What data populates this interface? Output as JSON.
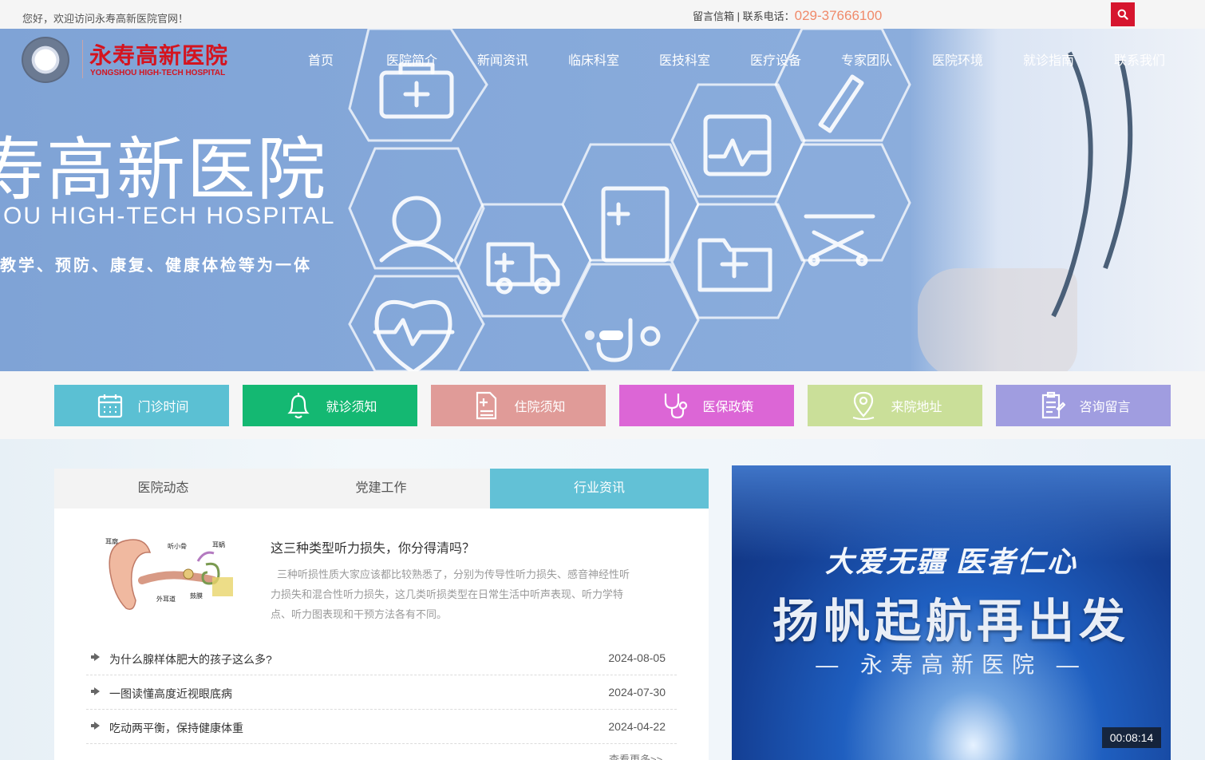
{
  "topbar": {
    "welcome": "您好，欢迎访问永寿高新医院官网！",
    "contact_label": "留言信箱 | 联系电话：",
    "phone": "029-37666100"
  },
  "logo": {
    "name_cn": "永寿高新医院",
    "name_en": "YONGSHOU HIGH-TECH HOSPITAL"
  },
  "nav": [
    "首页",
    "医院简介",
    "新闻资讯",
    "临床科室",
    "医技科室",
    "医疗设备",
    "专家团队",
    "医院环境",
    "就诊指南",
    "联系我们"
  ],
  "hero": {
    "title": "寿高新医院",
    "subtitle_en": "OU HIGH-TECH HOSPITAL",
    "slogan": "教学、预防、康复、健康体检等为一体",
    "slide_count": 2,
    "active_slide": 2
  },
  "quick_links": [
    {
      "label": "门诊时间",
      "color": "#5bc0d3",
      "icon": "calendar-icon"
    },
    {
      "label": "就诊须知",
      "color": "#14b872",
      "icon": "bell-icon"
    },
    {
      "label": "住院须知",
      "color": "#e09b98",
      "icon": "hospital-doc-icon"
    },
    {
      "label": "医保政策",
      "color": "#dc66d6",
      "icon": "stethoscope-icon"
    },
    {
      "label": "来院地址",
      "color": "#cadf99",
      "icon": "location-icon"
    },
    {
      "label": "咨询留言",
      "color": "#a09de0",
      "icon": "clipboard-icon"
    }
  ],
  "news": {
    "tabs": [
      "医院动态",
      "党建工作",
      "行业资讯"
    ],
    "active_tab": 2,
    "feature": {
      "title": "这三种类型听力损失，你分得清吗？",
      "desc": "三种听损性质大家应该都比较熟悉了，分别为传导性听力损失、感音神经性听力损失和混合性听力损失，这几类听损类型在日常生活中听声表现、听力学特点、听力图表现和干预方法各有不同。",
      "image_labels": {
        "pinna": "耳廓",
        "ossicles": "听小骨",
        "cochlea": "耳蜗",
        "canal": "外耳道",
        "eardrum": "鼓膜"
      }
    },
    "items": [
      {
        "title": "为什么腺样体肥大的孩子这么多?",
        "date": "2024-08-05"
      },
      {
        "title": "一图读懂高度近视眼底病",
        "date": "2024-07-30"
      },
      {
        "title": "吃动两平衡，保持健康体重",
        "date": "2024-04-22"
      }
    ],
    "more": "查看更多>>"
  },
  "video": {
    "line1": "大爱无疆 医者仁心",
    "line2": "扬帆起航再出发",
    "line3": "— 永寿高新医院 —",
    "duration": "00:08:14"
  }
}
